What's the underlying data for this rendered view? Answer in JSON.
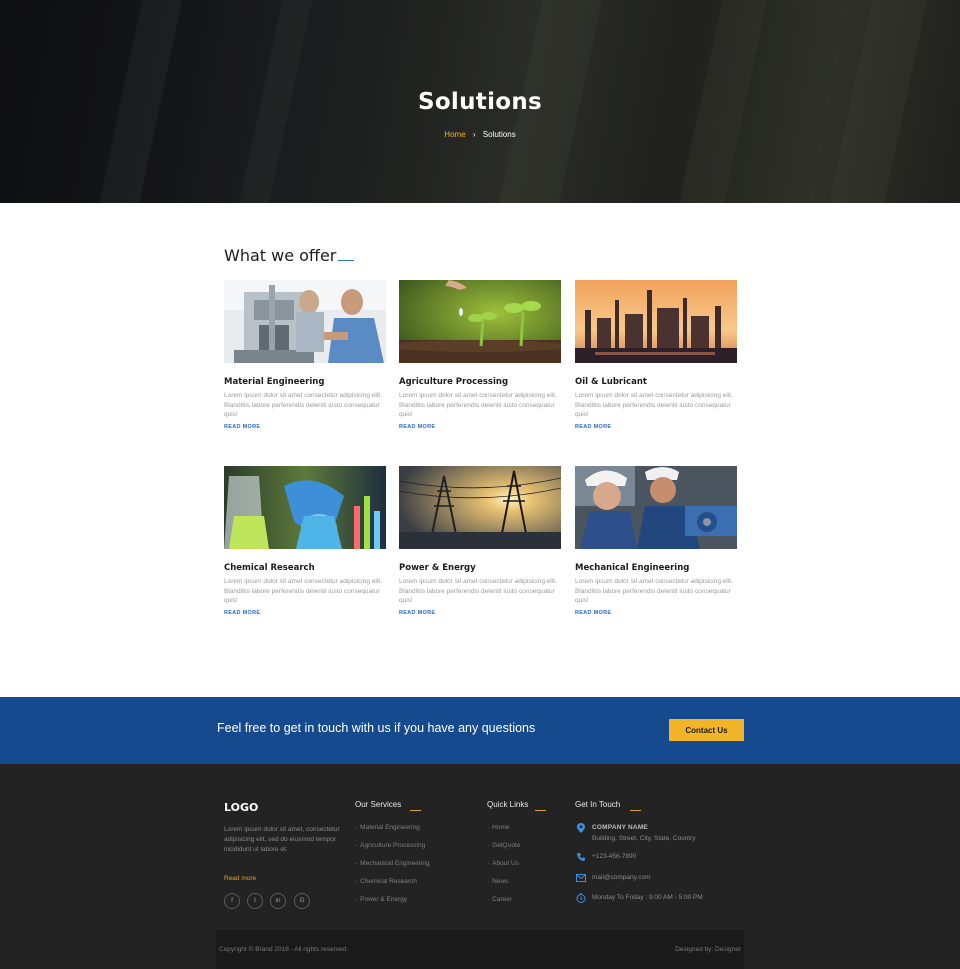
{
  "hero": {
    "title": "Solutions",
    "breadcrumb": {
      "home": "Home",
      "separator": "›",
      "current": "Solutions"
    }
  },
  "offer": {
    "title": "What we offer",
    "read_more": "READ MORE",
    "cards": [
      {
        "name": "Material Engineering",
        "desc": "Lorem ipsum dolor sit amet consectetur adipisicing elit. Blanditiis labore perferendis deleniti iusto consequatur quis!"
      },
      {
        "name": "Agriculture Processing",
        "desc": "Lorem ipsum dolor sit amet consectetur adipisicing elit. Blanditiis labore perferendis deleniti iusto consequatur quis!"
      },
      {
        "name": "Oil & Lubricant",
        "desc": "Lorem ipsum dolor sit amet consectetur adipisicing elit. Blanditiis labore perferendis deleniti iusto consequatur quis!"
      },
      {
        "name": "Chemical Research",
        "desc": "Lorem ipsum dolor sit amet consectetur adipisicing elit. Blanditiis labore perferendis deleniti iusto consequatur quis!"
      },
      {
        "name": "Power & Energy",
        "desc": "Lorem ipsum dolor sit amet consectetur adipisicing elit. Blanditiis labore perferendis deleniti iusto consequatur quis!"
      },
      {
        "name": "Mechanical Engineering",
        "desc": "Lorem ipsum dolor sit amet consectetur adipisicing elit. Blanditiis labore perferendis deleniti iusto consequatur quis!"
      }
    ]
  },
  "cta": {
    "text": "Feel free to get in touch with us if you have any questions",
    "button": "Contact Us"
  },
  "footer": {
    "logo": "LOGO",
    "about": "Lorem ipsum dolor sit amet, consectetur adipisicing elit, sed do eiusmod tempor incididunt ut labore et.",
    "read_more": "Read more",
    "social": [
      "f",
      "t",
      "in",
      "G"
    ],
    "services_title": "Our Services",
    "services": [
      "Material Engineering",
      "Agriculture Processing",
      "Mechanical Engineering",
      "Chemical Research",
      "Power & Energy"
    ],
    "links_title": "Quick Links",
    "links": [
      "Home",
      "GetQuote",
      "About Us",
      "News",
      "Career"
    ],
    "contact_title": "Get In Touch",
    "company_name": "COMPANY NAME",
    "address": "Building, Street, City, State, Country",
    "phone": "+123-456-7890",
    "email": "mail@company.com",
    "hours": "Monday To Friday : 9:00 AM - 5:00 PM",
    "copyright": "Copyright © Brand 2018 - All rights reserved.",
    "designed_by": "Designed by: Designer"
  },
  "colors": {
    "accent_blue": "#2c6fd6",
    "cta_blue": "#164a8e",
    "yellow": "#f2b529",
    "footer_bg": "#232323"
  }
}
